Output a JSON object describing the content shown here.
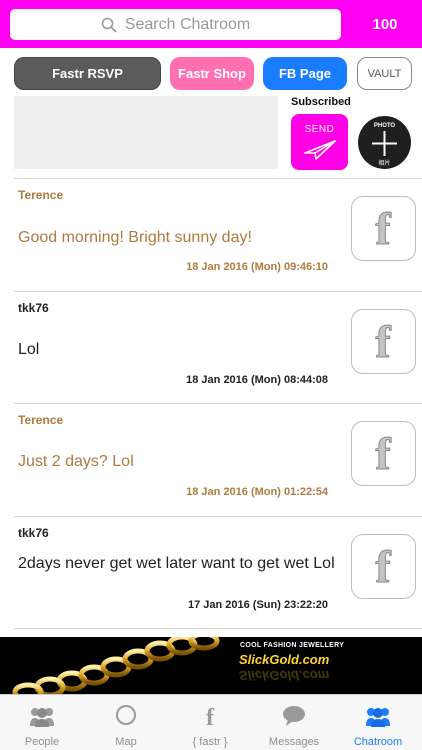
{
  "search": {
    "placeholder": "Search Chatroom"
  },
  "header": {
    "count": "100"
  },
  "buttons": {
    "rsvp": "Fastr RSVP",
    "shop": "Fastr Shop",
    "fb": "FB Page",
    "vault": "VAULT"
  },
  "compose": {
    "subscribed": "Subscribed",
    "send_label": "SEND",
    "photo_label": "PHOTO",
    "photo_sublabel": "相片"
  },
  "messages": [
    {
      "user": "Terence",
      "text": "Good morning! Bright sunny day!",
      "time": "18 Jan 2016 (Mon) 09:46:10",
      "avatar_letter": "f"
    },
    {
      "user": "tkk76",
      "text": "Lol",
      "time": "18 Jan 2016 (Mon) 08:44:08",
      "avatar_letter": "f"
    },
    {
      "user": "Terence",
      "text": "Just 2 days? Lol",
      "time": "18 Jan 2016 (Mon) 01:22:54",
      "avatar_letter": "f"
    },
    {
      "user": "tkk76",
      "text": "2days never get wet later want to get wet Lol",
      "time": "17 Jan 2016 (Sun) 23:22:20",
      "avatar_letter": "f"
    }
  ],
  "ad": {
    "tagline": "COOL FASHION JEWELLERY",
    "brand": "SlickGold.com"
  },
  "tabs": [
    {
      "label": "People",
      "icon": "people-icon"
    },
    {
      "label": "Map",
      "icon": "compass-icon"
    },
    {
      "label": "{ fastr }",
      "icon": "fastr-logo-icon"
    },
    {
      "label": "Messages",
      "icon": "speech-bubble-icon"
    },
    {
      "label": "Chatroom",
      "icon": "chatroom-icon",
      "active": true
    }
  ],
  "colors": {
    "header": "#ff00f2",
    "accent_blue": "#1a7cff",
    "username_terence": "#b17a3f"
  }
}
